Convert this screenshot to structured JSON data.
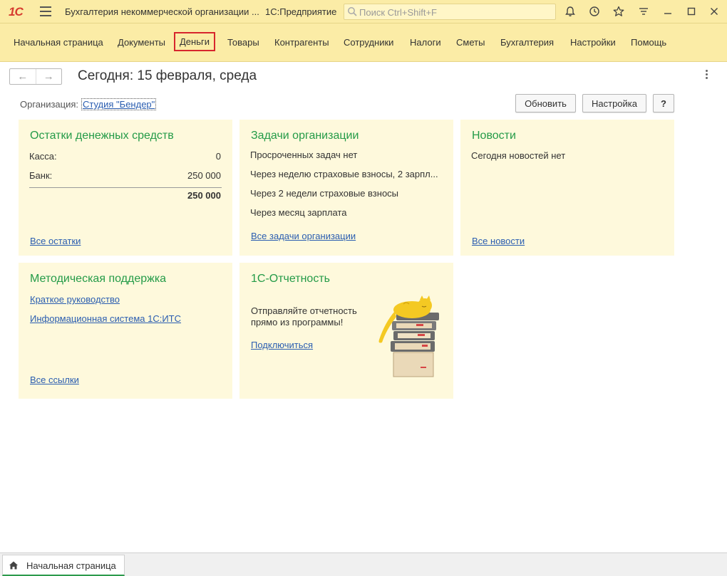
{
  "app": {
    "logo": "1С",
    "title": "Бухгалтерия некоммерческой организации ...",
    "platform": "1С:Предприятие",
    "search_placeholder": "Поиск Ctrl+Shift+F"
  },
  "titlebar_icons": [
    "bell-icon",
    "history-icon",
    "star-icon",
    "funnel-icon",
    "minimize-icon",
    "maximize-icon",
    "close-icon"
  ],
  "sections": [
    {
      "label": "Начальная страница",
      "active": false
    },
    {
      "label": "Документы",
      "active": false
    },
    {
      "label": "Деньги",
      "active": true
    },
    {
      "label": "Товары",
      "active": false
    },
    {
      "label": "Контрагенты",
      "active": false
    },
    {
      "label": "Сотрудники",
      "active": false
    },
    {
      "label": "Налоги",
      "active": false
    },
    {
      "label": "Сметы",
      "active": false
    },
    {
      "label": "Бухгалтерия",
      "active": false
    },
    {
      "label": "Настройки",
      "active": false
    },
    {
      "label": "Помощь",
      "active": false
    }
  ],
  "page": {
    "heading": "Сегодня: 15 февраля, среда",
    "org_label": "Организация:",
    "org_value": "Студия \"Бендер\"",
    "btn_refresh": "Обновить",
    "btn_settings": "Настройка",
    "btn_help": "?"
  },
  "cash": {
    "title": "Остатки денежных средств",
    "rows": [
      {
        "label": "Касса:",
        "value": "0"
      },
      {
        "label": "Банк:",
        "value": "250 000"
      }
    ],
    "total": "250 000",
    "link": "Все остатки"
  },
  "tasks": {
    "title": "Задачи организации",
    "items": [
      "Просроченных задач нет",
      "Через неделю страховые взносы, 2 зарпл...",
      "Через 2 недели страховые взносы",
      "Через месяц зарплата"
    ],
    "link": "Все задачи организации"
  },
  "news": {
    "title": "Новости",
    "text": "Сегодня новостей нет",
    "link": "Все новости"
  },
  "support": {
    "title": "Методическая поддержка",
    "links": [
      "Краткое руководство",
      "Информационная система 1С:ИТС"
    ],
    "all_link": "Все ссылки"
  },
  "reporting": {
    "title": "1С-Отчетность",
    "text_line1": "Отправляйте отчетность",
    "text_line2": "прямо из программы!",
    "link": "Подключиться"
  },
  "bottom_tab": {
    "label": "Начальная страница"
  },
  "colors": {
    "header_bg": "#fbeca6",
    "panel_bg": "#fef9dc",
    "title_green": "#249b48",
    "link_blue": "#2a5db0",
    "active_outline": "#d7262d"
  }
}
